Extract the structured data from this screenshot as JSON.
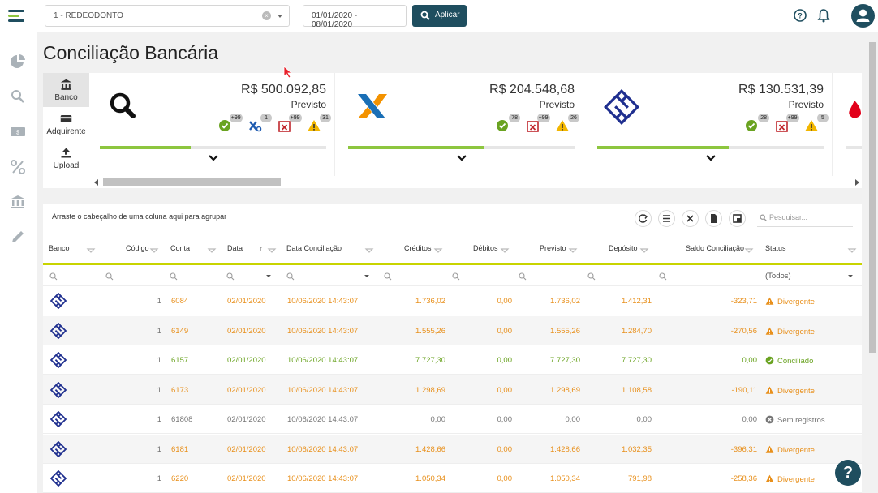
{
  "topbar": {
    "company": "1 - REDEODONTO",
    "date_range": "01/01/2020 - 08/01/2020",
    "apply_label": "Aplicar"
  },
  "page_title": "Conciliação Bancária",
  "tabs": [
    {
      "label": "Banco",
      "icon": "bank-icon"
    },
    {
      "label": "Adquirente",
      "icon": "card-icon"
    },
    {
      "label": "Upload",
      "icon": "upload-icon"
    }
  ],
  "cards": [
    {
      "amount": "R$ 500.092,85",
      "label": "Previsto",
      "logo": "search-icon",
      "counts": [
        "+99",
        "1",
        "+99",
        "31"
      ],
      "progress": 0.4
    },
    {
      "amount": "R$ 204.548,68",
      "label": "Previsto",
      "logo": "caixa-logo",
      "counts": [
        "78",
        "+99",
        "26"
      ],
      "progress": 0.6
    },
    {
      "amount": "R$ 130.531,39",
      "label": "Previsto",
      "logo": "banco-do-brasil-logo",
      "counts": [
        "28",
        "+99",
        "5"
      ],
      "progress": 0.58
    }
  ],
  "grid": {
    "group_hint": "Arraste o cabeçalho de uma coluna aqui para agrupar",
    "search_placeholder": "Pesquisar...",
    "headers": [
      "Banco",
      "Código",
      "Conta",
      "Data",
      "Data Conciliação",
      "Créditos",
      "Débitos",
      "Previsto",
      "Depósito",
      "Saldo Conciliação",
      "Status"
    ],
    "status_filter": "(Todos)",
    "rows": [
      {
        "codigo": "1",
        "conta": "6084",
        "data": "02/01/2020",
        "data_conc": "10/06/2020 14:43:07",
        "creditos": "1.736,02",
        "debitos": "0,00",
        "previsto": "1.736,02",
        "deposito": "1.412,31",
        "saldo": "-323,71",
        "status": "Divergente",
        "kind": "div"
      },
      {
        "codigo": "1",
        "conta": "6149",
        "data": "02/01/2020",
        "data_conc": "10/06/2020 14:43:07",
        "creditos": "1.555,26",
        "debitos": "0,00",
        "previsto": "1.555,26",
        "deposito": "1.284,70",
        "saldo": "-270,56",
        "status": "Divergente",
        "kind": "div"
      },
      {
        "codigo": "1",
        "conta": "6157",
        "data": "02/01/2020",
        "data_conc": "10/06/2020 14:43:07",
        "creditos": "7.727,30",
        "debitos": "0,00",
        "previsto": "7.727,30",
        "deposito": "7.727,30",
        "saldo": "0,00",
        "status": "Conciliado",
        "kind": "ok"
      },
      {
        "codigo": "1",
        "conta": "6173",
        "data": "02/01/2020",
        "data_conc": "10/06/2020 14:43:07",
        "creditos": "1.298,69",
        "debitos": "0,00",
        "previsto": "1.298,69",
        "deposito": "1.108,58",
        "saldo": "-190,11",
        "status": "Divergente",
        "kind": "div"
      },
      {
        "codigo": "1",
        "conta": "61808",
        "data": "02/01/2020",
        "data_conc": "10/06/2020 14:43:07",
        "creditos": "0,00",
        "debitos": "0,00",
        "previsto": "0,00",
        "deposito": "0,00",
        "saldo": "0,00",
        "status": "Sem registros",
        "kind": "none"
      },
      {
        "codigo": "1",
        "conta": "6181",
        "data": "02/01/2020",
        "data_conc": "10/06/2020 14:43:07",
        "creditos": "1.428,66",
        "debitos": "0,00",
        "previsto": "1.428,66",
        "deposito": "1.032,35",
        "saldo": "-396,31",
        "status": "Divergente",
        "kind": "div"
      },
      {
        "codigo": "1",
        "conta": "6220",
        "data": "02/01/2020",
        "data_conc": "10/06/2020 14:43:07",
        "creditos": "1.050,34",
        "debitos": "0,00",
        "previsto": "1.050,34",
        "deposito": "791,98",
        "saldo": "-258,36",
        "status": "Divergente",
        "kind": "div"
      }
    ]
  },
  "colors": {
    "primary": "#1f4e5f",
    "accent": "#8dc63f",
    "warning": "#e8901c",
    "success": "#6aa321"
  }
}
